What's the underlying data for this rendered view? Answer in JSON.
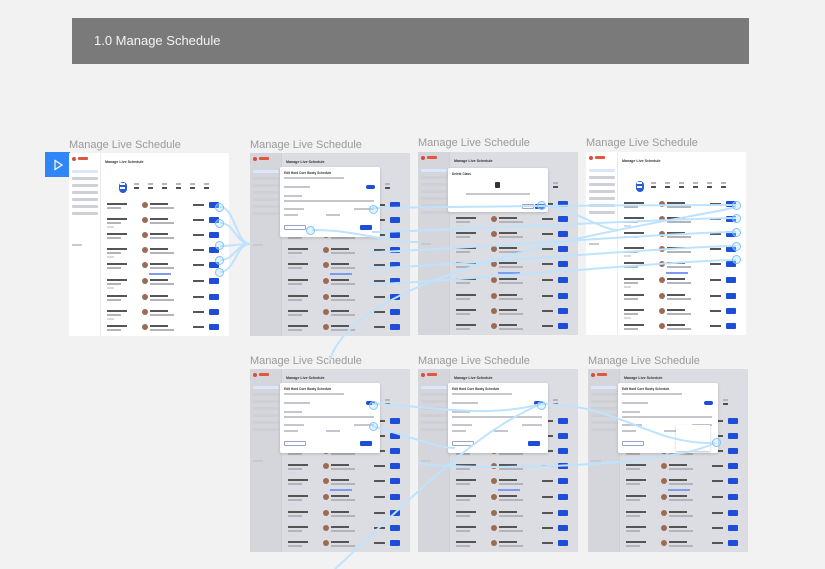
{
  "header": {
    "title": "1.0 Manage Schedule",
    "background_color": "#7a7a7a"
  },
  "prototype": {
    "play_icon": "play-icon",
    "accent_color": "#2f86f6",
    "link_color": "#bfe3ff"
  },
  "frames": [
    {
      "label": "Manage Live Schedule",
      "heading": "Manage Live Schedule",
      "state": "default"
    },
    {
      "label": "Manage Live Schedule",
      "heading": "Manage Live Schedule",
      "state": "edit-modal",
      "modal_title": "Edit Hard Core Booty Schedule"
    },
    {
      "label": "Manage Live Schedule",
      "heading": "Manage Live Schedule",
      "state": "delete-modal",
      "modal_title": "Delete Class"
    },
    {
      "label": "Manage Live Schedule",
      "heading": "Manage Live Schedule",
      "state": "default"
    },
    {
      "label": "Manage Live Schedule",
      "heading": "Manage Live Schedule",
      "state": "edit-modal",
      "modal_title": "Edit Hard Core Booty Schedule"
    },
    {
      "label": "Manage Live Schedule",
      "heading": "Manage Live Schedule",
      "state": "edit-modal-blank",
      "modal_title": "Edit Hard Core Booty Schedule"
    },
    {
      "label": "Manage Live Schedule",
      "heading": "Manage Live Schedule",
      "state": "edit-modal-dropdown",
      "modal_title": "Edit Hard Core Booty Schedule"
    }
  ]
}
